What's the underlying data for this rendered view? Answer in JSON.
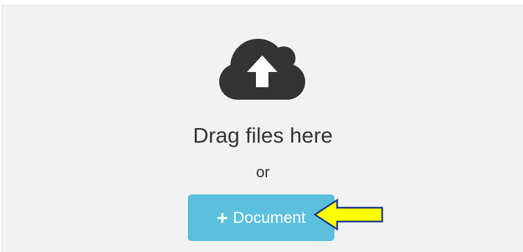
{
  "dropzone": {
    "icon": "cloud-upload-icon",
    "heading": "Drag files here",
    "separator": "or",
    "button": {
      "icon": "plus-icon",
      "plus_glyph": "+",
      "label": "Document"
    }
  },
  "annotation": {
    "icon": "arrow-left-icon",
    "color": "#ffff00"
  },
  "colors": {
    "panel": "#f2f2f2",
    "icon": "#333333",
    "button": "#5bc0de"
  }
}
